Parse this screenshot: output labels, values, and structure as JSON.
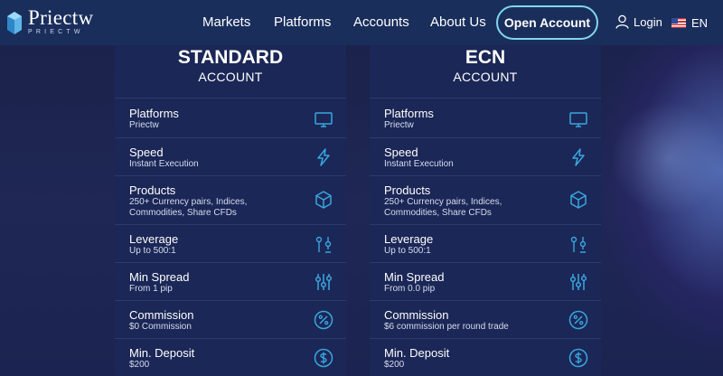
{
  "brand": {
    "name": "Priectw",
    "subline": "PRIECTW"
  },
  "nav": {
    "items": [
      "Markets",
      "Platforms",
      "Accounts",
      "About Us"
    ],
    "cta": "Open Account",
    "login": "Login",
    "language": "EN"
  },
  "accounts": [
    {
      "title": "STANDARD",
      "subtitle": "ACCOUNT",
      "rows": [
        {
          "label": "Platforms",
          "value": "Priectw",
          "value2": "",
          "icon": "monitor-icon"
        },
        {
          "label": "Speed",
          "value": "Instant Execution",
          "value2": "",
          "icon": "lightning-icon"
        },
        {
          "label": "Products",
          "value": "250+ Currency pairs, Indices,",
          "value2": "Commodities, Share CFDs",
          "icon": "cube-icon"
        },
        {
          "label": "Leverage",
          "value": "Up to 500:1",
          "value2": "",
          "icon": "leverage-icon"
        },
        {
          "label": "Min Spread",
          "value": "From 1 pip",
          "value2": "",
          "icon": "sliders-icon"
        },
        {
          "label": "Commission",
          "value": "$0 Commission",
          "value2": "",
          "icon": "percent-icon"
        },
        {
          "label": "Min. Deposit",
          "value": "$200",
          "value2": "",
          "icon": "dollar-icon"
        }
      ]
    },
    {
      "title": "ECN",
      "subtitle": "ACCOUNT",
      "rows": [
        {
          "label": "Platforms",
          "value": "Priectw",
          "value2": "",
          "icon": "monitor-icon"
        },
        {
          "label": "Speed",
          "value": "Instant Execution",
          "value2": "",
          "icon": "lightning-icon"
        },
        {
          "label": "Products",
          "value": "250+ Currency pairs, Indices,",
          "value2": "Commodities, Share CFDs",
          "icon": "cube-icon"
        },
        {
          "label": "Leverage",
          "value": "Up to 500:1",
          "value2": "",
          "icon": "leverage-icon"
        },
        {
          "label": "Min Spread",
          "value": "From 0.0 pip",
          "value2": "",
          "icon": "sliders-icon"
        },
        {
          "label": "Commission",
          "value": "$6 commission per round trade",
          "value2": "",
          "icon": "percent-icon"
        },
        {
          "label": "Min. Deposit",
          "value": "$200",
          "value2": "",
          "icon": "dollar-icon"
        }
      ]
    }
  ],
  "colors": {
    "nav_bg": "#1a2e5c",
    "card_bg": "#1b2756",
    "page_bg": "#1d2450",
    "icon_accent": "#3aa6e0",
    "cta_border": "#7fd6ea"
  }
}
